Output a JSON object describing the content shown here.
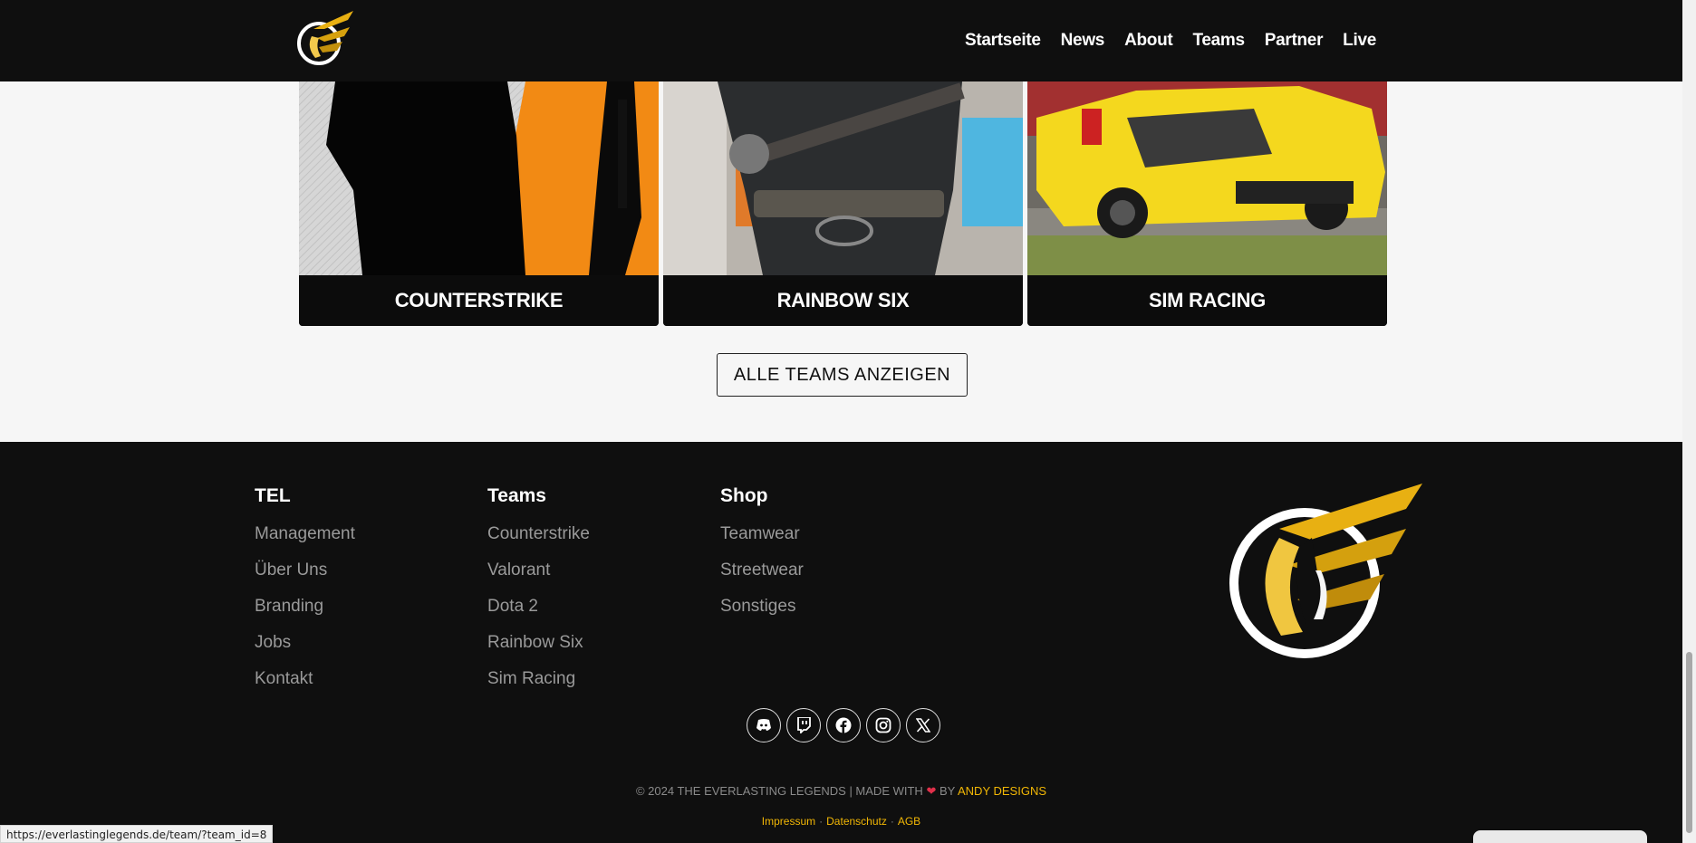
{
  "header": {
    "nav": [
      "Startseite",
      "News",
      "About",
      "Teams",
      "Partner",
      "Live"
    ]
  },
  "teams": {
    "cards": [
      {
        "label": "COUNTERSTRIKE"
      },
      {
        "label": "RAINBOW SIX"
      },
      {
        "label": "SIM RACING"
      }
    ],
    "all_button": "ALLE TEAMS ANZEIGEN"
  },
  "footer": {
    "columns": [
      {
        "title": "TEL",
        "links": [
          "Management",
          "Über Uns",
          "Branding",
          "Jobs",
          "Kontakt"
        ]
      },
      {
        "title": "Teams",
        "links": [
          "Counterstrike",
          "Valorant",
          "Dota 2",
          "Rainbow Six",
          "Sim Racing"
        ]
      },
      {
        "title": "Shop",
        "links": [
          "Teamwear",
          "Streetwear",
          "Sonstiges"
        ]
      }
    ],
    "socials": [
      "discord-icon",
      "twitch-icon",
      "facebook-icon",
      "instagram-icon",
      "x-icon"
    ],
    "copyright_prefix": "© 2024 THE EVERLASTING LEGENDS | MADE WITH",
    "copyright_by": "BY",
    "copyright_author": "ANDY DESIGNS",
    "legal": [
      "Impressum",
      "Datenschutz",
      "AGB"
    ]
  },
  "status_bar": {
    "url": "https://everlastinglegends.de/team/?team_id=8"
  },
  "colors": {
    "accent": "#f2b705",
    "background": "#0f0f0f",
    "heart": "#e0304a"
  }
}
